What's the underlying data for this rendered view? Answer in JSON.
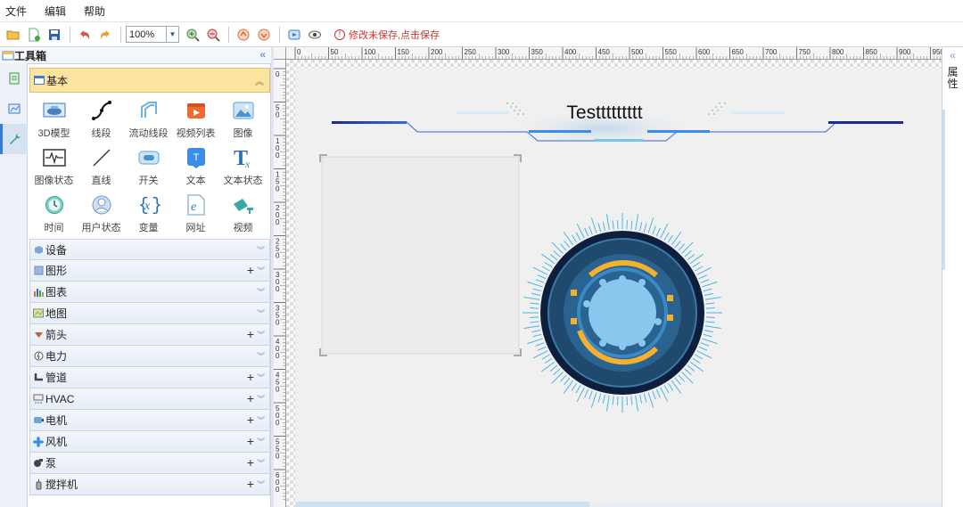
{
  "menu": {
    "file": "文件",
    "edit": "编辑",
    "help": "帮助"
  },
  "toolbar": {
    "zoom": "100%",
    "unsaved_message": "修改未保存,点击保存",
    "unsaved_icon": "!"
  },
  "toolbox": {
    "title": "工具箱",
    "collapse_glyph": "«",
    "basic_label": "基本",
    "basic_chevron": "︽",
    "items": [
      {
        "label": "3D模型",
        "icon": "3d-model-icon"
      },
      {
        "label": "线段",
        "icon": "line-segment-icon"
      },
      {
        "label": "流动线段",
        "icon": "flow-line-icon"
      },
      {
        "label": "视频列表",
        "icon": "video-list-icon"
      },
      {
        "label": "图像",
        "icon": "image-icon"
      },
      {
        "label": "图像状态",
        "icon": "image-state-icon"
      },
      {
        "label": "直线",
        "icon": "straight-line-icon"
      },
      {
        "label": "开关",
        "icon": "switch-icon"
      },
      {
        "label": "文本",
        "icon": "text-icon"
      },
      {
        "label": "文本状态",
        "icon": "text-state-icon"
      },
      {
        "label": "时间",
        "icon": "time-icon"
      },
      {
        "label": "用户状态",
        "icon": "user-state-icon"
      },
      {
        "label": "变量",
        "icon": "variable-icon"
      },
      {
        "label": "网址",
        "icon": "url-icon"
      },
      {
        "label": "视频",
        "icon": "video-icon"
      }
    ],
    "categories": [
      {
        "label": "设备",
        "plus": false
      },
      {
        "label": "图形",
        "plus": true
      },
      {
        "label": "图表",
        "plus": false
      },
      {
        "label": "地图",
        "plus": false
      },
      {
        "label": "箭头",
        "plus": true
      },
      {
        "label": "电力",
        "plus": false
      },
      {
        "label": "管道",
        "plus": true
      },
      {
        "label": "HVAC",
        "plus": true
      },
      {
        "label": "电机",
        "plus": true
      },
      {
        "label": "风机",
        "plus": true
      },
      {
        "label": "泵",
        "plus": true
      },
      {
        "label": "搅拌机",
        "plus": true
      }
    ]
  },
  "ruler": {
    "marks": [
      "0",
      "50",
      "100",
      "150",
      "200",
      "250",
      "300",
      "350",
      "400",
      "450",
      "500",
      "550",
      "600",
      "650",
      "700",
      "750",
      "800",
      "850",
      "900",
      "950"
    ],
    "left_marks": [
      "0",
      "50",
      "100",
      "150",
      "200",
      "250",
      "300",
      "350",
      "400",
      "450",
      "500",
      "550",
      "600"
    ]
  },
  "canvas": {
    "title_text": "Testtttttttt"
  },
  "properties": {
    "collapse_glyph": "«",
    "label": "属性"
  },
  "colors": {
    "accent": "#3a7bd5",
    "basic_header": "#fbe3a0",
    "unsaved": "#cc3333"
  }
}
